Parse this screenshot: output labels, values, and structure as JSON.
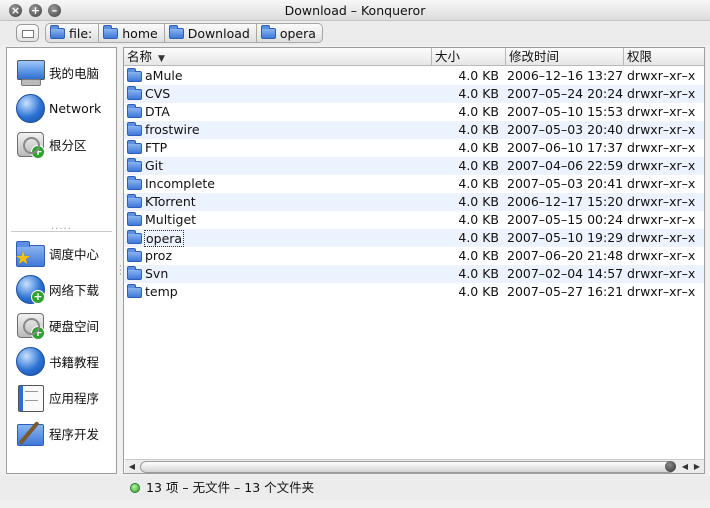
{
  "window": {
    "title": "Download – Konqueror",
    "controls": [
      "close",
      "maximize",
      "minimize"
    ]
  },
  "breadcrumb": [
    {
      "label": "file:"
    },
    {
      "label": "home"
    },
    {
      "label": "Download"
    },
    {
      "label": "opera"
    }
  ],
  "sidebar": {
    "top_items": [
      {
        "label": "我的电脑",
        "icon": "computer-icon"
      },
      {
        "label": "Network",
        "icon": "network-globe-icon"
      },
      {
        "label": "根分区",
        "icon": "drive-icon"
      }
    ],
    "bottom_items": [
      {
        "label": "调度中心",
        "icon": "folder-star-icon"
      },
      {
        "label": "网络下载",
        "icon": "globe-icon"
      },
      {
        "label": "硬盘空间",
        "icon": "drive-icon"
      },
      {
        "label": "书籍教程",
        "icon": "globe-icon"
      },
      {
        "label": "应用程序",
        "icon": "book-icon"
      },
      {
        "label": "程序开发",
        "icon": "tools-icon"
      }
    ]
  },
  "table": {
    "columns": {
      "name": "名称",
      "size": "大小",
      "modified": "修改时间",
      "permissions": "权限"
    },
    "sort_indicator": "▼",
    "rows": [
      {
        "name": "aMule",
        "size": "4.0 KB",
        "modified": "2006–12–16 13:27",
        "permissions": "drwxr–xr–x"
      },
      {
        "name": "CVS",
        "size": "4.0 KB",
        "modified": "2007–05–24 20:24",
        "permissions": "drwxr–xr–x"
      },
      {
        "name": "DTA",
        "size": "4.0 KB",
        "modified": "2007–05–10 15:53",
        "permissions": "drwxr–xr–x"
      },
      {
        "name": "frostwire",
        "size": "4.0 KB",
        "modified": "2007–05–03 20:40",
        "permissions": "drwxr–xr–x"
      },
      {
        "name": "FTP",
        "size": "4.0 KB",
        "modified": "2007–06–10 17:37",
        "permissions": "drwxr–xr–x"
      },
      {
        "name": "Git",
        "size": "4.0 KB",
        "modified": "2007–04–06 22:59",
        "permissions": "drwxr–xr–x"
      },
      {
        "name": "Incomplete",
        "size": "4.0 KB",
        "modified": "2007–05–03 20:41",
        "permissions": "drwxr–xr–x"
      },
      {
        "name": "KTorrent",
        "size": "4.0 KB",
        "modified": "2006–12–17 15:20",
        "permissions": "drwxr–xr–x"
      },
      {
        "name": "Multiget",
        "size": "4.0 KB",
        "modified": "2007–05–15 00:24",
        "permissions": "drwxr–xr–x"
      },
      {
        "name": "opera",
        "size": "4.0 KB",
        "modified": "2007–05–10 19:29",
        "permissions": "drwxr–xr–x"
      },
      {
        "name": "proz",
        "size": "4.0 KB",
        "modified": "2007–06–20 21:48",
        "permissions": "drwxr–xr–x"
      },
      {
        "name": "Svn",
        "size": "4.0 KB",
        "modified": "2007–02–04 14:57",
        "permissions": "drwxr–xr–x"
      },
      {
        "name": "temp",
        "size": "4.0 KB",
        "modified": "2007–05–27 16:21",
        "permissions": "drwxr–xr–x"
      }
    ],
    "focused_row": "opera"
  },
  "status": {
    "text": "13 项 – 无文件 – 13 个文件夹"
  }
}
